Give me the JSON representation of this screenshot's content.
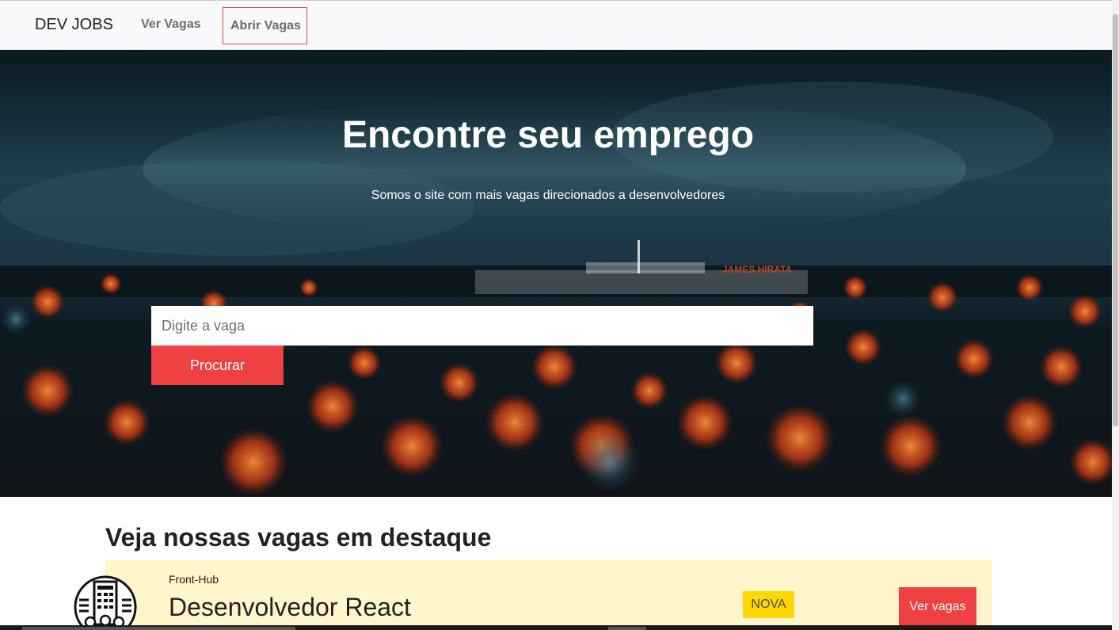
{
  "nav": {
    "brand": "DEV JOBS",
    "links": [
      {
        "label": "Ver Vagas"
      },
      {
        "label": "Abrir Vagas"
      }
    ]
  },
  "hero": {
    "title": "Encontre seu emprego",
    "subtitle": "Somos o site com mais vagas direcionados a desenvolvedores",
    "watermark": "JAMES HIRATA",
    "search": {
      "placeholder": "Digite a vaga",
      "value": "",
      "button_label": "Procurar"
    }
  },
  "featured": {
    "title": "Veja nossas vagas em destaque",
    "jobs": [
      {
        "company": "Front-Hub",
        "title": "Desenvolvedor React",
        "badge": "NOVA",
        "button_label": "Ver vagas",
        "logo_icon": "building-people-icon"
      }
    ]
  },
  "colors": {
    "accent_red": "#ef4141",
    "badge_yellow": "#ffd600",
    "card_bg": "#fff6cc",
    "navbar_bg": "#f8f9fa"
  }
}
